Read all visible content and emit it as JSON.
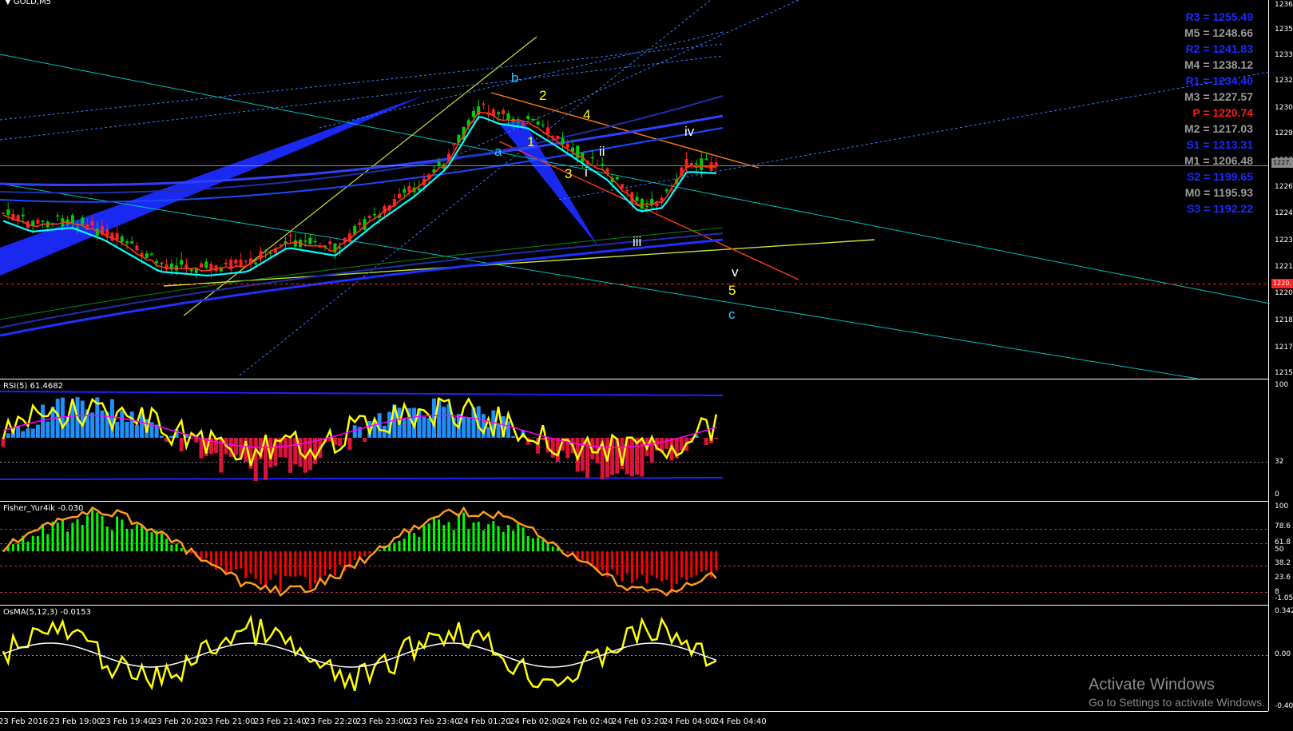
{
  "window": {
    "symbol_title": "GOLD,M5"
  },
  "panes": {
    "rsi_title": "RSI(5) 61.4682",
    "fisher_title": "Fisher_Yur4ik -0.030",
    "osma_title": "OsMA(5,12,3) -0.0153"
  },
  "pivots": [
    {
      "label": "R3 = 1255.49",
      "color": "#1a2bff"
    },
    {
      "label": "M5 = 1248.66",
      "color": "#9a9a9a"
    },
    {
      "label": "R2 = 1241.83",
      "color": "#1a2bff"
    },
    {
      "label": "M4 = 1238.12",
      "color": "#9a9a9a"
    },
    {
      "label": "R1 = 1234.40",
      "color": "#1a2bff"
    },
    {
      "label": "M3 = 1227.57",
      "color": "#9a9a9a"
    },
    {
      "label": "P   = 1220.74",
      "color": "#ff1a1a"
    },
    {
      "label": "M2 = 1217.03",
      "color": "#9a9a9a"
    },
    {
      "label": "S1 = 1213.31",
      "color": "#1a2bff"
    },
    {
      "label": "M1 = 1206.48",
      "color": "#9a9a9a"
    },
    {
      "label": "S2 = 1199.65",
      "color": "#1a2bff"
    },
    {
      "label": "M0 = 1195.93",
      "color": "#9a9a9a"
    },
    {
      "label": "S3 = 1192.22",
      "color": "#1a2bff"
    }
  ],
  "price_axis": [
    "1236.",
    "1235.",
    "1233.",
    "1232.",
    "1230.",
    "1229.",
    "1227.",
    "1226.",
    "1224.",
    "1223.",
    "1221.",
    "1220.",
    "1218.",
    "1217.",
    "1215."
  ],
  "current_price_badge": "1227.",
  "red_line_badge": "1220.",
  "rsi_axis": [
    "100",
    "32",
    "0"
  ],
  "fisher_axis": [
    "100",
    "78.6",
    "61.8",
    "50",
    "38.2",
    "23.6",
    "8",
    "-1.055"
  ],
  "osma_axis": [
    "0.342",
    "0.00",
    "-0.401"
  ],
  "time_axis": [
    "23 Feb 2016",
    "23 Feb 19:00",
    "23 Feb 19:40",
    "23 Feb 20:20",
    "23 Feb 21:00",
    "23 Feb 21:40",
    "23 Feb 22:20",
    "23 Feb 23:00",
    "23 Feb 23:40",
    "24 Feb 01:20",
    "24 Feb 02:00",
    "24 Feb 02:40",
    "24 Feb 03:20",
    "24 Feb 04:00",
    "24 Feb 04:40"
  ],
  "wave_labels": [
    {
      "text": "b",
      "color": "#2ec8ff"
    },
    {
      "text": "2",
      "color": "#ffff00"
    },
    {
      "text": "4",
      "color": "#ffff00"
    },
    {
      "text": "iv",
      "color": "#ffffff"
    },
    {
      "text": "a",
      "color": "#2ec8ff"
    },
    {
      "text": "1",
      "color": "#ffff00"
    },
    {
      "text": "ii",
      "color": "#ffffff"
    },
    {
      "text": "3",
      "color": "#ffff00"
    },
    {
      "text": "i",
      "color": "#ffffff"
    },
    {
      "text": "iii",
      "color": "#ffffff"
    },
    {
      "text": "v",
      "color": "#ffffff"
    },
    {
      "text": "5",
      "color": "#ffff00"
    },
    {
      "text": "c",
      "color": "#2ec8ff"
    }
  ],
  "watermark": {
    "title": "Activate Windows",
    "subtitle": "Go to Settings to activate Windows."
  },
  "colors": {
    "background": "#000000",
    "bull_candle": "#00d000",
    "bear_candle": "#ff2020",
    "rsi_up_bar": "#1e90ff",
    "rsi_down_bar": "#dc143c",
    "fisher_up_bar": "#00ff00",
    "fisher_down_bar": "#ff0000",
    "signal_line": "#ffff00",
    "channel_fill": "#1a2bff",
    "trend_line": "#00c0c0"
  }
}
